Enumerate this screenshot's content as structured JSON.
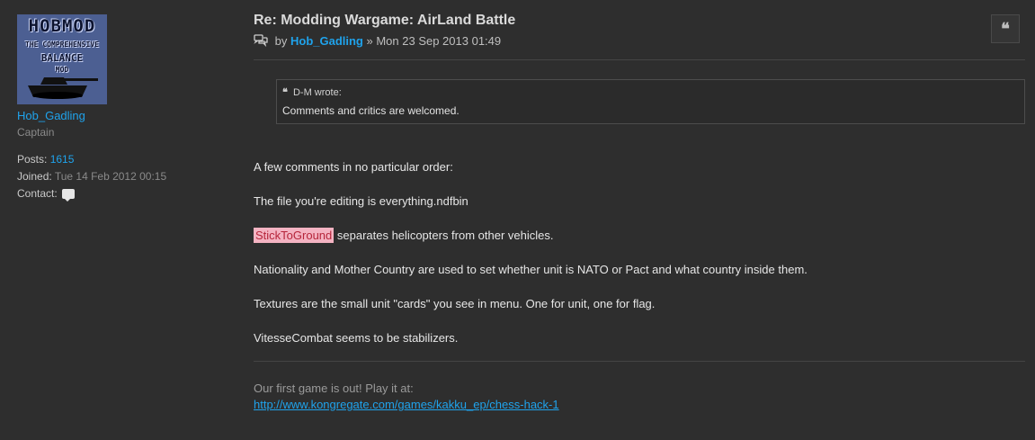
{
  "profile": {
    "avatar_text": [
      "HOBMOD",
      "THE COMPREHENSIVE",
      "BALANCE",
      "MOD"
    ],
    "username": "Hob_Gadling",
    "rank": "Captain",
    "posts_label": "Posts:",
    "posts_value": "1615",
    "joined_label": "Joined:",
    "joined_value": "Tue 14 Feb 2012 00:15",
    "contact_label": "Contact:",
    "contact_icon": "speech-bubble-icon"
  },
  "post": {
    "title": "Re: Modding Wargame: AirLand Battle",
    "meta_by": "by",
    "author": "Hob_Gadling",
    "date": "» Mon 23 Sep 2013 01:49",
    "quote_button_icon": "quote-icon",
    "quote_glyph": "❝",
    "blockquote": {
      "cite": "D-M wrote:",
      "text": "Comments and critics are welcomed."
    },
    "paragraphs": {
      "p1": "A few comments in no particular order:",
      "p2": "The file you're editing is everything.ndfbin",
      "p3_highlight": "StickToGround",
      "p3_rest": " separates helicopters from other vehicles.",
      "p4": "Nationality and Mother Country are used to set whether unit is NATO or Pact and what country inside them.",
      "p5": "Textures are the small unit \"cards\" you see in menu. One for unit, one for flag.",
      "p6": "VitesseCombat seems to be stabilizers."
    },
    "signature": {
      "text": "Our first game is out! Play it at:",
      "link": "http://www.kongregate.com/games/kakku_ep/chess-hack-1"
    }
  },
  "colors": {
    "background": "#2e2e2e",
    "link": "#1fa3ec",
    "highlight_bg": "#f4b3c2",
    "highlight_fg": "#b5253a"
  }
}
